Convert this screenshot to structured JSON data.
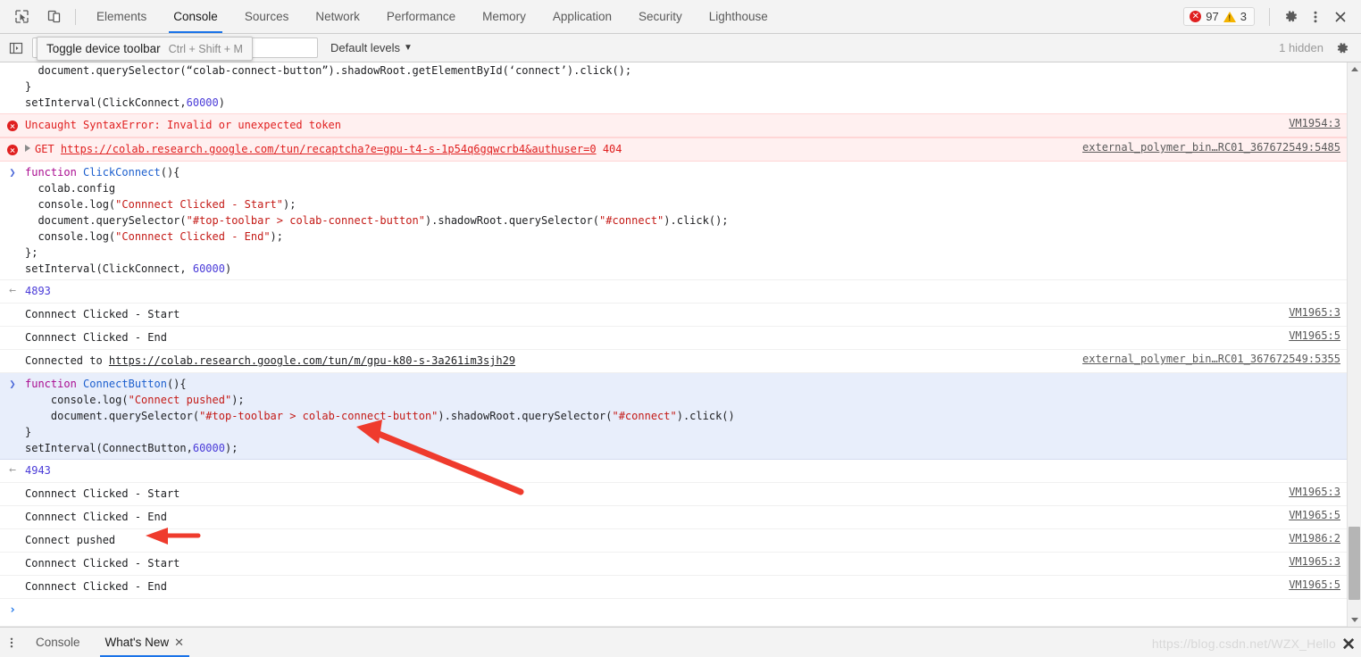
{
  "toolbar": {
    "inspect_icon": "inspect-element-icon",
    "device_icon": "device-toolbar-icon",
    "tabs": [
      {
        "label": "Elements",
        "active": false
      },
      {
        "label": "Console",
        "active": true
      },
      {
        "label": "Sources",
        "active": false
      },
      {
        "label": "Network",
        "active": false
      },
      {
        "label": "Performance",
        "active": false
      },
      {
        "label": "Memory",
        "active": false
      },
      {
        "label": "Application",
        "active": false
      },
      {
        "label": "Security",
        "active": false
      },
      {
        "label": "Lighthouse",
        "active": false
      }
    ],
    "error_count": "97",
    "warning_count": "3",
    "settings_icon": "gear-icon",
    "more_icon": "more-vertical-icon",
    "close_icon": "close-icon"
  },
  "console_toolbar": {
    "sidebar_icon": "show-console-sidebar-icon",
    "filter_placeholder": "Filter",
    "filter_value": "",
    "levels_label": "Default levels",
    "levels_caret": "▼",
    "hidden_label": "1 hidden",
    "settings_icon": "console-settings-gear-icon",
    "tooltip": {
      "label": "Toggle device toolbar",
      "shortcut": "Ctrl + Shift + M"
    }
  },
  "console": {
    "messages": [
      {
        "kind": "code-continuation",
        "lines": [
          [
            {
              "t": "  document.querySelector(“colab-connect-button”).shadowRoot.getElementById(‘connect’).click();",
              "c": "pln"
            }
          ],
          [
            {
              "t": "}",
              "c": "pln"
            }
          ],
          [
            {
              "t": "setInterval(ClickConnect,",
              "c": "pln"
            },
            {
              "t": "60000",
              "c": "num"
            },
            {
              "t": ")",
              "c": "pln"
            }
          ]
        ]
      },
      {
        "kind": "error",
        "text": "Uncaught SyntaxError: Invalid or unexpected token",
        "source": "VM1954:3"
      },
      {
        "kind": "error-network",
        "method": "GET",
        "url": "https://colab.research.google.com/tun/recaptcha?e=gpu-t4-s-1p54q6gqwcrb4&authuser=0",
        "status": "404",
        "source": "external_polymer_bin…RC01_367672549:5485"
      },
      {
        "kind": "input",
        "highlight": false,
        "lines": [
          [
            {
              "t": "function ",
              "c": "kw"
            },
            {
              "t": "ClickConnect",
              "c": "fn"
            },
            {
              "t": "(){",
              "c": "pln"
            }
          ],
          [
            {
              "t": "  colab.config",
              "c": "pln"
            }
          ],
          [
            {
              "t": "  console.log(",
              "c": "pln"
            },
            {
              "t": "\"Connnect Clicked - Start\"",
              "c": "str"
            },
            {
              "t": ");",
              "c": "pln"
            }
          ],
          [
            {
              "t": "  document.querySelector(",
              "c": "pln"
            },
            {
              "t": "\"#top-toolbar > colab-connect-button\"",
              "c": "str"
            },
            {
              "t": ").shadowRoot.querySelector(",
              "c": "pln"
            },
            {
              "t": "\"#connect\"",
              "c": "str"
            },
            {
              "t": ").click();",
              "c": "pln"
            }
          ],
          [
            {
              "t": "  console.log(",
              "c": "pln"
            },
            {
              "t": "\"Connnect Clicked - End\"",
              "c": "str"
            },
            {
              "t": ");",
              "c": "pln"
            }
          ],
          [
            {
              "t": "};",
              "c": "pln"
            }
          ],
          [
            {
              "t": "setInterval(ClickConnect, ",
              "c": "pln"
            },
            {
              "t": "60000",
              "c": "num"
            },
            {
              "t": ")",
              "c": "pln"
            }
          ]
        ]
      },
      {
        "kind": "result",
        "value": "4893"
      },
      {
        "kind": "log",
        "text": "Connnect Clicked - Start",
        "source": "VM1965:3"
      },
      {
        "kind": "log",
        "text": "Connnect Clicked - End",
        "source": "VM1965:5"
      },
      {
        "kind": "log-link",
        "prefix": "Connected to ",
        "url": "https://colab.research.google.com/tun/m/gpu-k80-s-3a261im3sjh29",
        "source": "external_polymer_bin…RC01_367672549:5355"
      },
      {
        "kind": "input",
        "highlight": true,
        "lines": [
          [
            {
              "t": "function ",
              "c": "kw"
            },
            {
              "t": "ConnectButton",
              "c": "fn"
            },
            {
              "t": "(){",
              "c": "pln"
            }
          ],
          [
            {
              "t": "    console.log(",
              "c": "pln"
            },
            {
              "t": "\"Connect pushed\"",
              "c": "str"
            },
            {
              "t": ");",
              "c": "pln"
            }
          ],
          [
            {
              "t": "    document.querySelector(",
              "c": "pln"
            },
            {
              "t": "\"#top-toolbar > colab-connect-button\"",
              "c": "str"
            },
            {
              "t": ").shadowRoot.querySelector(",
              "c": "pln"
            },
            {
              "t": "\"#connect\"",
              "c": "str"
            },
            {
              "t": ").click()",
              "c": "pln"
            }
          ],
          [
            {
              "t": "}",
              "c": "pln"
            }
          ],
          [
            {
              "t": "setInterval(ConnectButton,",
              "c": "pln"
            },
            {
              "t": "60000",
              "c": "num"
            },
            {
              "t": ");",
              "c": "pln"
            }
          ]
        ]
      },
      {
        "kind": "result",
        "value": "4943"
      },
      {
        "kind": "log",
        "text": "Connnect Clicked - Start",
        "source": "VM1965:3"
      },
      {
        "kind": "log",
        "text": "Connnect Clicked - End",
        "source": "VM1965:5"
      },
      {
        "kind": "log",
        "text": "Connect pushed",
        "source": "VM1986:2"
      },
      {
        "kind": "log",
        "text": "Connnect Clicked - Start",
        "source": "VM1965:3"
      },
      {
        "kind": "log",
        "text": "Connnect Clicked - End",
        "source": "VM1965:5"
      }
    ],
    "prompt_chevron": "›"
  },
  "drawer": {
    "menu_icon": "more-vertical-icon",
    "tabs": [
      {
        "label": "Console",
        "active": false,
        "closable": false
      },
      {
        "label": "What's New",
        "active": true,
        "closable": true
      }
    ],
    "close_glyph": "✕"
  },
  "watermark": {
    "text": "https://blog.csdn.net/WZX_Hello",
    "close_glyph": "✕"
  },
  "colors": {
    "accent": "#1a73e8",
    "error": "#e02020",
    "warning": "#f5b400",
    "highlight_row": "#e8eefb",
    "error_row": "#fff0f0",
    "annotation_arrow": "#ef3b2d"
  }
}
